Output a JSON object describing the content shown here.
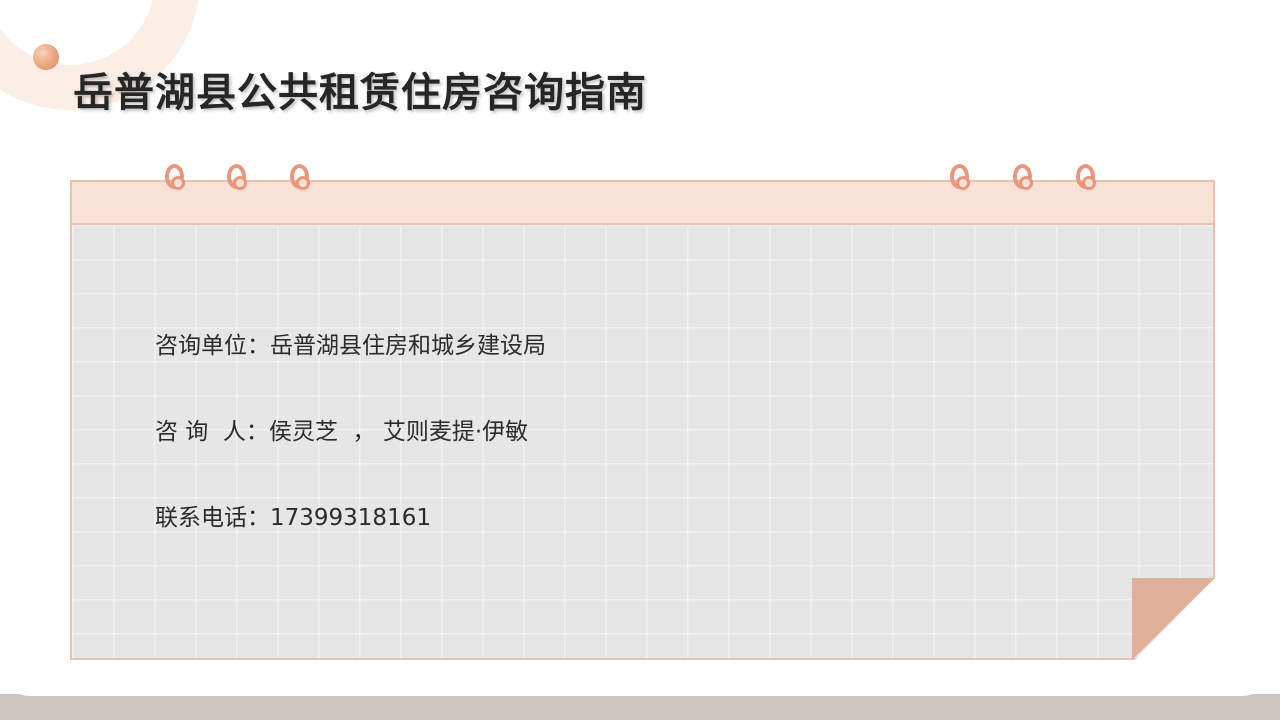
{
  "slide": {
    "title": "岳普湖县公共租赁住房咨询指南",
    "info": [
      {
        "label": "咨询单位：",
        "value": "岳普湖县住房和城乡建设局"
      },
      {
        "label": "咨 询  人：",
        "value": "侯灵芝  ， 艾则麦提·伊敏"
      },
      {
        "label": "联系电话：",
        "value": "17399318161"
      }
    ]
  },
  "colors": {
    "accent": "#e9967a",
    "header_fill": "#f8e2d8",
    "grid_fill": "#e6e6e6",
    "page_curl": "#e1b09b",
    "title_text": "#262626"
  },
  "icons": [
    "binder-ring-icon",
    "decorative-dot-icon"
  ]
}
